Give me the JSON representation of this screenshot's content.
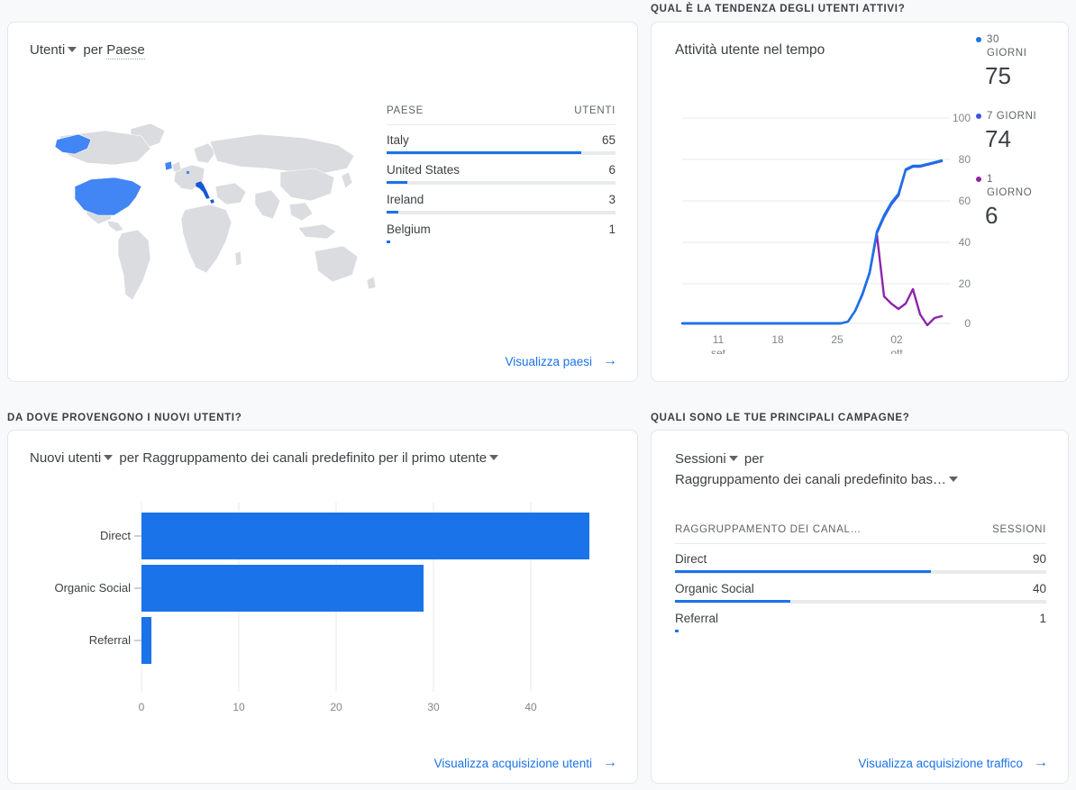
{
  "sections": {
    "trend_header": "QUAL È LA TENDENZA DEGLI UTENTI ATTIVI?",
    "acquisition_header": "DA DOVE PROVENGONO I NUOVI UTENTI?",
    "campaigns_header": "QUALI SONO LE TUE PRINCIPALI CAMPAGNE?"
  },
  "map_card": {
    "metric": "Utenti",
    "by": "per",
    "dimension": "Paese",
    "table": {
      "col_dimension": "PAESE",
      "col_metric": "UTENTI",
      "rows": [
        {
          "label": "Italy",
          "value": "65",
          "pct": 85
        },
        {
          "label": "United States",
          "value": "6",
          "pct": 9
        },
        {
          "label": "Ireland",
          "value": "3",
          "pct": 5
        },
        {
          "label": "Belgium",
          "value": "1",
          "pct": 1.5
        }
      ]
    },
    "link": "Visualizza paesi",
    "arrow": "→",
    "highlight_color": "#4285f4",
    "map_base_color": "#dadce0"
  },
  "trend_card": {
    "title": "Attività utente nel tempo",
    "legend": [
      {
        "period_line1": "30",
        "period_line2": "GIORNI",
        "value": "75",
        "color": "#1a73e8"
      },
      {
        "period_line1": "7 GIORNI",
        "period_line2": "",
        "value": "74",
        "color": "#3f51e8"
      },
      {
        "period_line1": "1",
        "period_line2": "GIORNO",
        "value": "6",
        "color": "#8e24aa"
      }
    ]
  },
  "acquisition_card": {
    "metric": "Nuovi utenti",
    "by": "per",
    "dimension": "Raggruppamento dei canali predefinito per il primo utente",
    "link": "Visualizza acquisizione utenti",
    "arrow": "→"
  },
  "campaigns_card": {
    "metric": "Sessioni",
    "by": "per",
    "dimension": "Raggruppamento dei canali predefinito bas…",
    "table": {
      "col_dimension": "RAGGRUPPAMENTO DEI CANAL…",
      "col_metric": "SESSIONI",
      "rows": [
        {
          "label": "Direct",
          "value": "90",
          "pct": 69
        },
        {
          "label": "Organic Social",
          "value": "40",
          "pct": 31
        },
        {
          "label": "Referral",
          "value": "1",
          "pct": 1
        }
      ]
    },
    "link": "Visualizza acquisizione traffico",
    "arrow": "→"
  },
  "chart_data": [
    {
      "type": "line",
      "title": "Attività utente nel tempo",
      "xlabel": "",
      "ylabel": "",
      "ylim": [
        0,
        100
      ],
      "yticks": [
        "0",
        "20",
        "40",
        "60",
        "80",
        "100"
      ],
      "xticks": [
        {
          "line1": "11",
          "line2": "set",
          "pos": 0.155
        },
        {
          "line1": "18",
          "line2": "",
          "pos": 0.37
        },
        {
          "line1": "25",
          "line2": "",
          "pos": 0.585
        },
        {
          "line1": "02",
          "line2": "ott",
          "pos": 0.8
        }
      ],
      "grid": true,
      "legend_position": "right",
      "series": [
        {
          "name": "30 GIORNI",
          "color": "#1a73e8",
          "values": [
            1,
            1,
            1,
            1,
            1,
            1,
            1,
            1,
            1,
            1,
            1,
            1,
            1,
            1,
            1,
            1,
            1,
            1,
            1,
            2,
            6,
            13,
            25,
            46,
            52,
            58,
            62,
            74,
            75,
            75,
            78
          ]
        },
        {
          "name": "7 GIORNI",
          "color": "#3f51e8",
          "values": [
            1,
            1,
            1,
            1,
            1,
            1,
            1,
            1,
            1,
            1,
            1,
            1,
            1,
            1,
            1,
            1,
            1,
            1,
            1,
            2,
            6,
            13,
            25,
            45,
            52,
            58,
            62,
            74,
            75,
            74,
            78
          ]
        },
        {
          "name": "1 GIORNO",
          "color": "#8e24aa",
          "values": [
            1,
            1,
            1,
            1,
            1,
            1,
            1,
            1,
            1,
            1,
            1,
            1,
            1,
            1,
            1,
            1,
            1,
            1,
            1,
            2,
            6,
            13,
            24,
            43,
            13,
            9,
            12,
            17,
            5,
            1,
            6
          ]
        }
      ]
    },
    {
      "type": "bar",
      "orientation": "horizontal",
      "title": "Nuovi utenti per Raggruppamento dei canali predefinito per il primo utente",
      "categories": [
        "Direct",
        "Organic Social",
        "Referral"
      ],
      "values": [
        46,
        29,
        1
      ],
      "xlabel": "",
      "ylabel": "",
      "xlim": [
        0,
        50
      ],
      "xticks": [
        "0",
        "10",
        "20",
        "30",
        "40",
        "50"
      ],
      "grid": true,
      "color": "#1a73e8"
    },
    {
      "type": "table",
      "title": "Sessioni per Raggruppamento dei canali predefinito bas…",
      "columns": [
        "RAGGRUPPAMENTO DEI CANAL…",
        "SESSIONI"
      ],
      "rows": [
        [
          "Direct",
          90
        ],
        [
          "Organic Social",
          40
        ],
        [
          "Referral",
          1
        ]
      ]
    },
    {
      "type": "table",
      "title": "Utenti per Paese",
      "columns": [
        "PAESE",
        "UTENTI"
      ],
      "rows": [
        [
          "Italy",
          65
        ],
        [
          "United States",
          6
        ],
        [
          "Ireland",
          3
        ],
        [
          "Belgium",
          1
        ]
      ]
    }
  ]
}
